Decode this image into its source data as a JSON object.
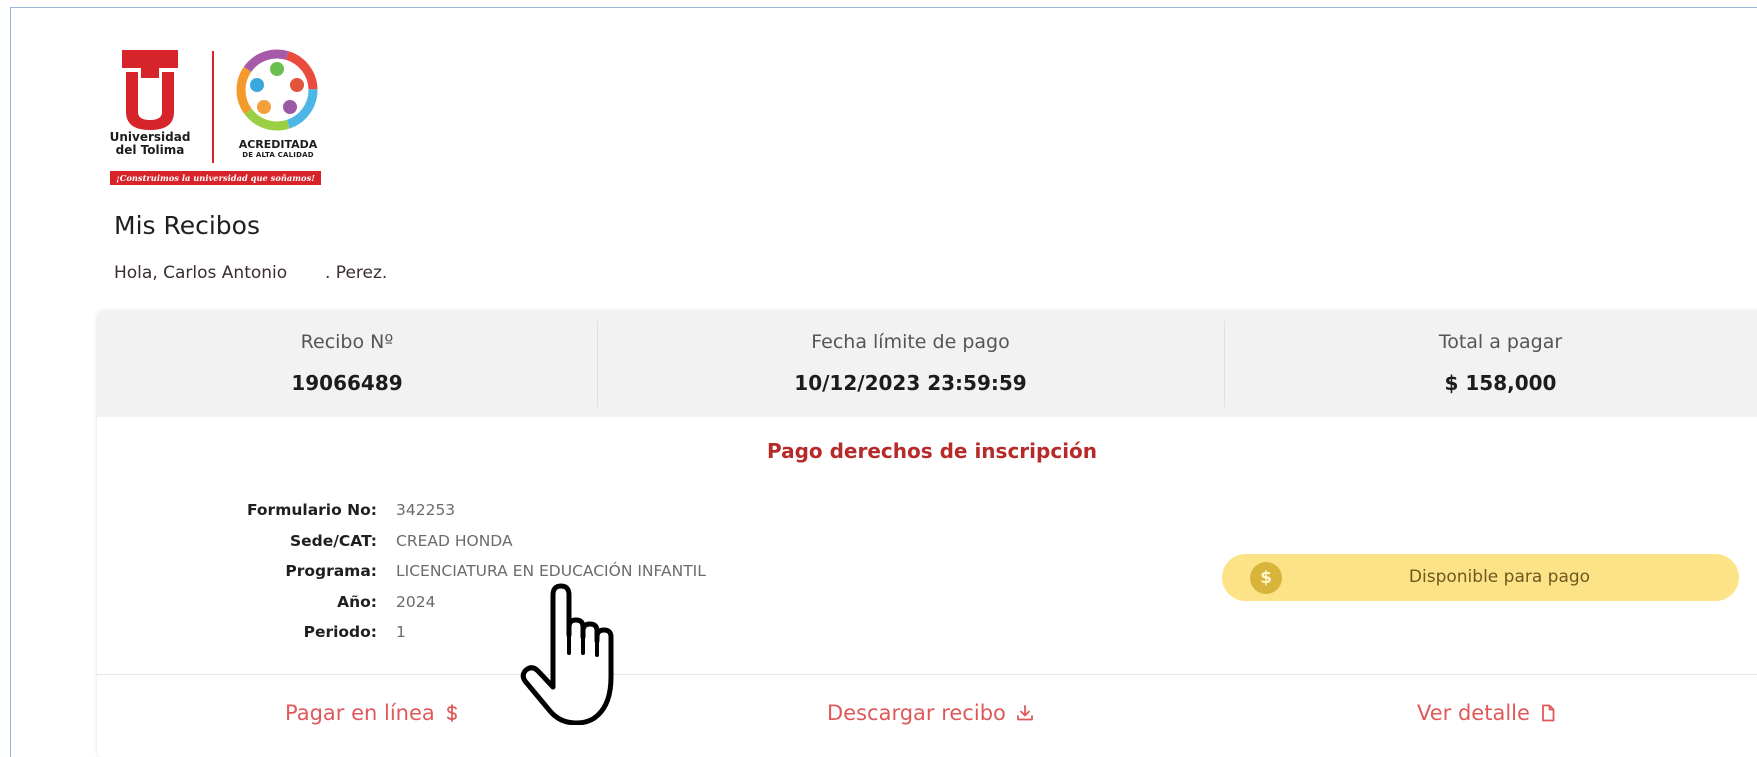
{
  "logo": {
    "university_line1": "Universidad",
    "university_line2": "del Tolima",
    "accredited": "ACREDITADA",
    "accredited_sub": "DE ALTA CALIDAD",
    "slogan": "¡Construimos la universidad que soñamos!",
    "brand_color": "#d6242a"
  },
  "page": {
    "title": "Mis Recibos",
    "greeting_prefix": "Hola, Carlos Antonio",
    "greeting_suffix": ". Perez."
  },
  "receipt": {
    "number_label": "Recibo Nº",
    "number_value": "19066489",
    "due_label": "Fecha límite de pago",
    "due_value": "10/12/2023 23:59:59",
    "total_label": "Total a pagar",
    "total_value": "$ 158,000",
    "concept": "Pago derechos de inscripción",
    "details": [
      {
        "key": "Formulario No:",
        "value": "342253"
      },
      {
        "key": "Sede/CAT:",
        "value": "CREAD HONDA"
      },
      {
        "key": "Programa:",
        "value": "LICENCIATURA EN EDUCACIÓN INFANTIL"
      },
      {
        "key": "Año:",
        "value": "2024"
      },
      {
        "key": "Periodo:",
        "value": "1"
      }
    ],
    "status": {
      "icon": "dollar-coin-icon",
      "label": "Disponible para pago",
      "color": "#fde387"
    }
  },
  "actions": {
    "pay_online": "Pagar en línea",
    "download": "Descargar recibo",
    "view_detail": "Ver detalle"
  },
  "colors": {
    "accent": "#e0595a",
    "concept": "#b72a2a"
  }
}
